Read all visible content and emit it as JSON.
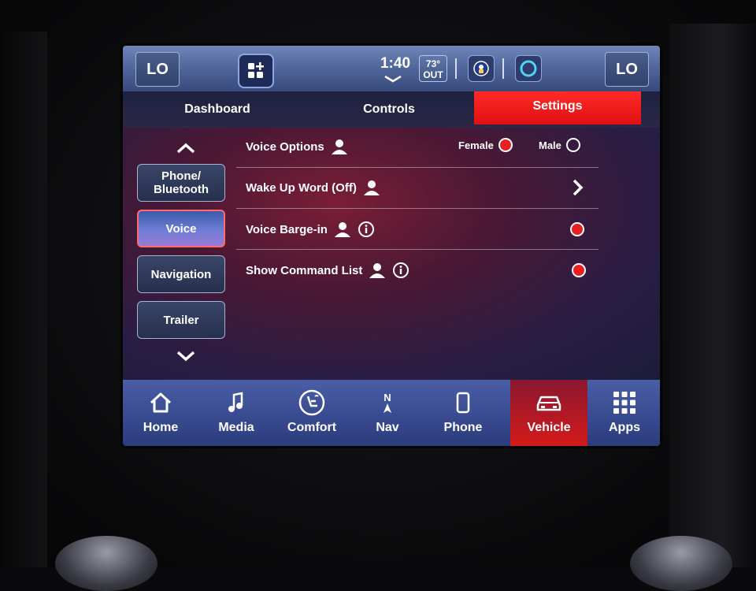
{
  "status_bar": {
    "left_temp": "LO",
    "right_temp": "LO",
    "time": "1:40",
    "outside_temp": "73°",
    "outside_label": "OUT",
    "icons": [
      "widget-grid-icon",
      "driver-assist-icon",
      "alexa-icon"
    ]
  },
  "tabs": [
    {
      "label": "Dashboard",
      "active": false
    },
    {
      "label": "Controls",
      "active": false
    },
    {
      "label": "Settings",
      "active": true
    }
  ],
  "sidebar": {
    "items": [
      {
        "label": "Phone/\nBluetooth",
        "active": false
      },
      {
        "label": "Voice",
        "active": true
      },
      {
        "label": "Navigation",
        "active": false
      },
      {
        "label": "Trailer",
        "active": false
      }
    ]
  },
  "settings": {
    "voice_options": {
      "label": "Voice Options",
      "female_label": "Female",
      "male_label": "Male",
      "selected": "Female"
    },
    "wake_up_word": {
      "label": "Wake Up Word (Off)"
    },
    "voice_barge_in": {
      "label": "Voice Barge-in",
      "enabled": true
    },
    "show_command_list": {
      "label": "Show Command List",
      "enabled": true
    }
  },
  "nav": {
    "items": [
      {
        "label": "Home",
        "icon": "home-icon",
        "active": false
      },
      {
        "label": "Media",
        "icon": "music-note-icon",
        "active": false
      },
      {
        "label": "Comfort",
        "icon": "seat-comfort-icon",
        "active": false
      },
      {
        "label": "Nav",
        "icon": "compass-icon",
        "active": false
      },
      {
        "label": "Phone",
        "icon": "phone-icon",
        "active": false
      },
      {
        "label": "Vehicle",
        "icon": "vehicle-icon",
        "active": true
      },
      {
        "label": "Apps",
        "icon": "apps-grid-icon",
        "active": false
      }
    ],
    "compass_n": "N"
  },
  "colors": {
    "accent_red": "#e82020",
    "status_bar": "#4d6297",
    "nav_bar": "#3a4d92"
  }
}
